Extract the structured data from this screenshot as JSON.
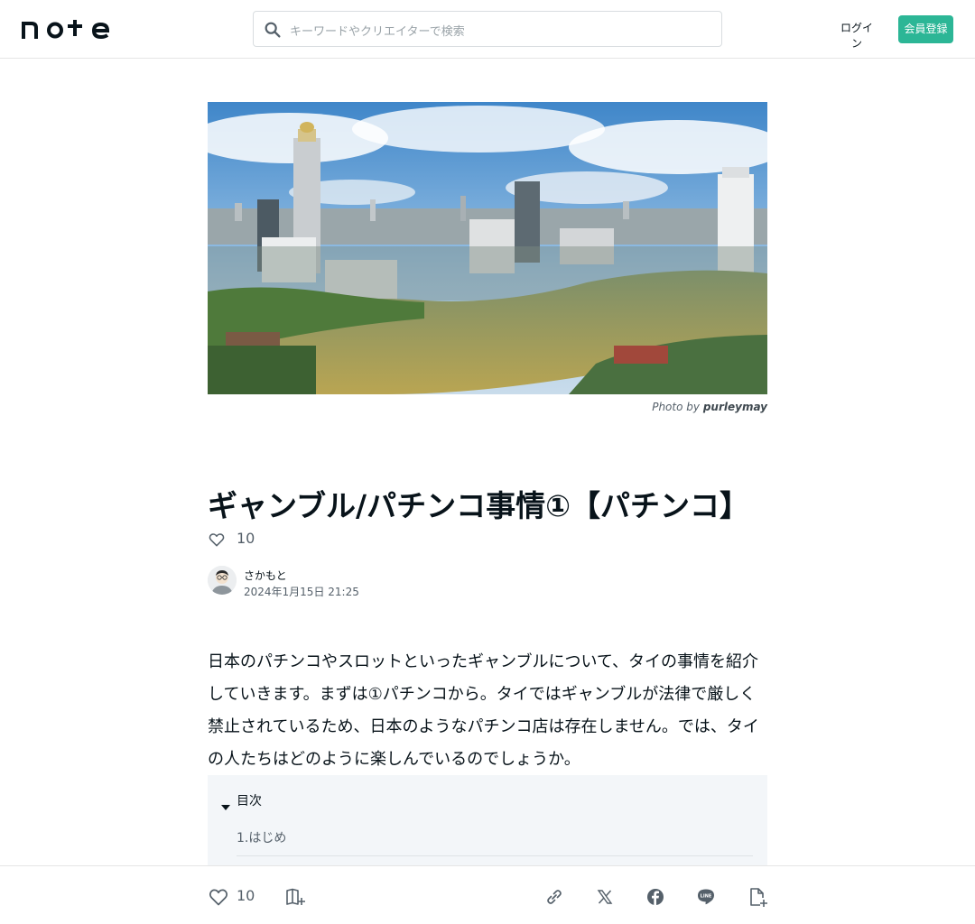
{
  "header": {
    "logo_text": "note",
    "search_placeholder": "キーワードやクリエイターで検索",
    "login_label": "ログイン",
    "signup_label": "会員登録"
  },
  "hero": {
    "credit_prefix": "Photo by",
    "credit_author": "purleymay"
  },
  "article": {
    "title": "ギャンブル/パチンコ事情①【パチンコ】",
    "like_count": "10",
    "author_name": "さかもと",
    "date": "2024年1月15日 21:25",
    "body": "日本のパチンコやスロットといったギャンブルについて、タイの事情を紹介していきます。まずは①パチンコから。タイではギャンブルが法律で厳しく禁止されているため、日本のようなパチンコ店は存在しません。では、タイの人たちはどのように楽しんでいるのでしょうか。"
  },
  "toc": {
    "title": "目次",
    "items": [
      "1.はじめ"
    ]
  },
  "bottom_bar": {
    "like_count": "10"
  },
  "colors": {
    "brand_green": "#2cb696",
    "text": "#08131a",
    "muted": "#55606a"
  }
}
